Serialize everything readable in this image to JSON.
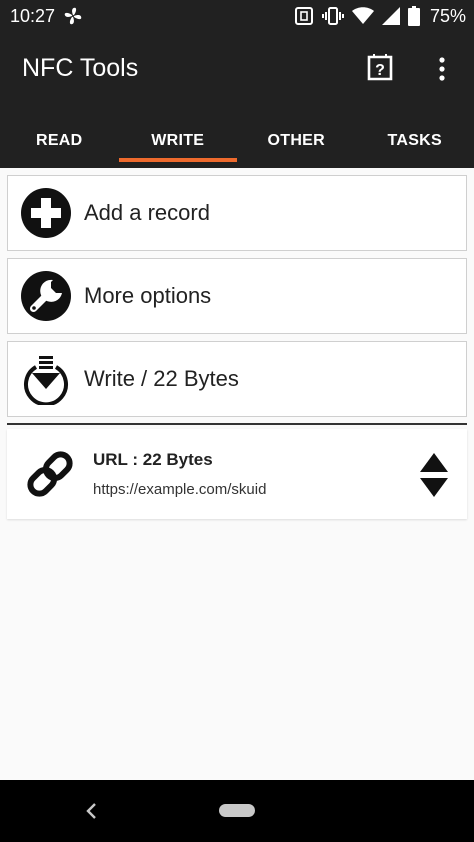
{
  "status_bar": {
    "time": "10:27",
    "battery": "75%",
    "icons": [
      "fan-icon",
      "nfc-icon",
      "vibrate-icon",
      "wifi-icon",
      "signal-icon",
      "battery-icon"
    ]
  },
  "app_bar": {
    "title": "NFC Tools",
    "icons": [
      "help-icon",
      "overflow-menu-icon"
    ]
  },
  "tabs": [
    {
      "label": "READ",
      "active": false
    },
    {
      "label": "WRITE",
      "active": true
    },
    {
      "label": "OTHER",
      "active": false
    },
    {
      "label": "TASKS",
      "active": false
    }
  ],
  "actions": [
    {
      "label": "Add a record",
      "icon": "add-circle-icon"
    },
    {
      "label": "More options",
      "icon": "wrench-icon"
    },
    {
      "label": "Write / 22 Bytes",
      "icon": "write-download-icon"
    }
  ],
  "record": {
    "title": "URL : 22 Bytes",
    "value": "https://example.com/skuid",
    "icon": "link-icon"
  },
  "colors": {
    "app_bar": "#212121",
    "accent": "#ee6a2d",
    "background": "#fafafa"
  }
}
